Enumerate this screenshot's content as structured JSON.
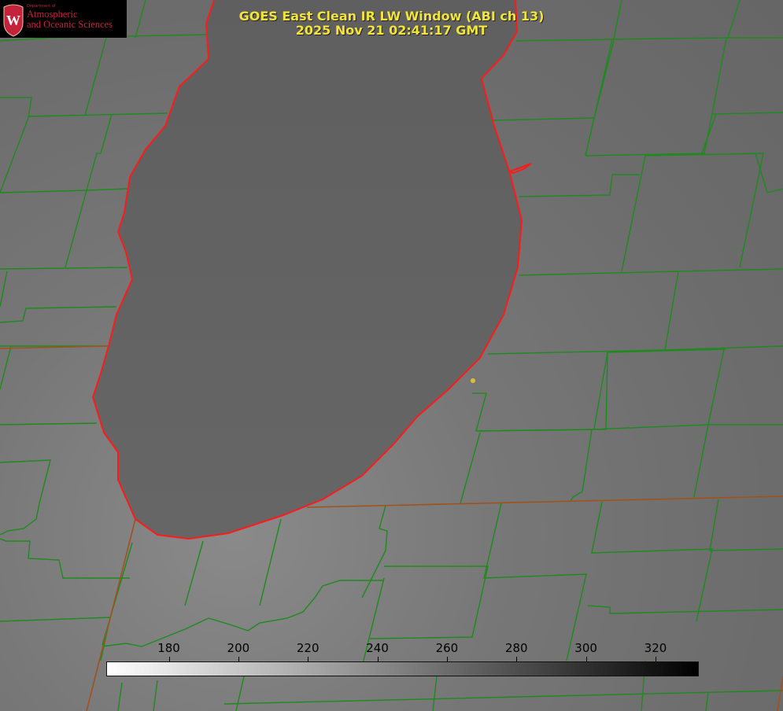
{
  "title": {
    "line1": "GOES East Clean IR LW Window (ABI ch 13)",
    "line2": "2025 Nov 21 02:41:17 GMT"
  },
  "logo": {
    "dept": "Department of",
    "line1": "Atmospheric",
    "line2": "and Oceanic Sciences",
    "seal_letter": "W",
    "color": "#c4243b"
  },
  "colorbar": {
    "ticks": [
      "180",
      "200",
      "220",
      "240",
      "260",
      "280",
      "300",
      "320"
    ],
    "range": [
      162,
      332
    ],
    "colors": [
      "#ffffff",
      "#000000"
    ]
  },
  "colors": {
    "lake_outline": "#ff1a1a",
    "county_lines": "#1e8a1e",
    "state_lines": "#a0521e",
    "title": "#f2e43a"
  }
}
